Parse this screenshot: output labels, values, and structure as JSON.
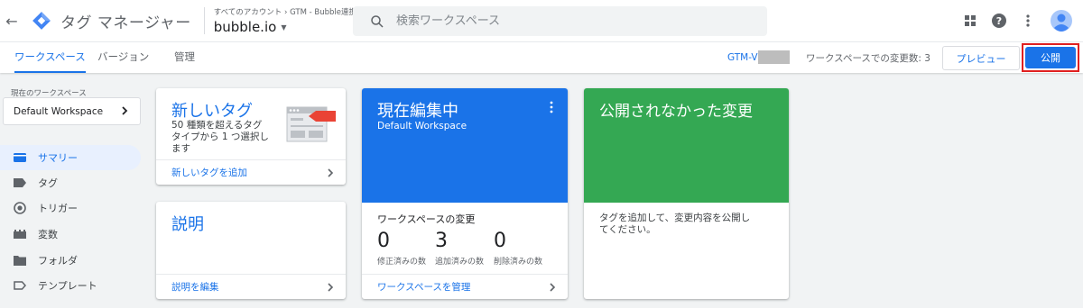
{
  "header": {
    "app_title": "タグ マネージャー",
    "account_path": "すべてのアカウント › GTM - Bubble連携",
    "container_name": "bubble.io",
    "search_placeholder": "検索ワークスペース"
  },
  "nav": {
    "tabs": [
      {
        "label": "ワークスペース",
        "active": true
      },
      {
        "label": "バージョン",
        "active": false
      },
      {
        "label": "管理",
        "active": false
      }
    ],
    "gtm_id": "GTM-V",
    "changes_text": "ワークスペースでの変更数: 3",
    "preview_label": "プレビュー",
    "publish_label": "公開"
  },
  "sidebar": {
    "current_ws_label": "現在のワークスペース",
    "current_ws": "Default Workspace",
    "items": [
      {
        "label": "サマリー",
        "icon": "summary-icon",
        "active": true
      },
      {
        "label": "タグ",
        "icon": "tag-icon",
        "active": false
      },
      {
        "label": "トリガー",
        "icon": "trigger-icon",
        "active": false
      },
      {
        "label": "変数",
        "icon": "variables-icon",
        "active": false
      },
      {
        "label": "フォルダ",
        "icon": "folder-icon",
        "active": false
      },
      {
        "label": "テンプレート",
        "icon": "template-icon",
        "active": false
      }
    ]
  },
  "cards": {
    "new_tag": {
      "title": "新しいタグ",
      "desc_lines": [
        "50 種類を超えるタグ",
        "タイプから 1 つ選択し",
        "ます"
      ],
      "link": "新しいタグを追加"
    },
    "description": {
      "title": "説明",
      "link": "説明を編集"
    },
    "editing": {
      "title": "現在編集中",
      "subtitle": "Default Workspace",
      "changes_title": "ワークスペースの変更",
      "stats": [
        {
          "value": "0",
          "label": "修正済みの数"
        },
        {
          "value": "3",
          "label": "追加済みの数"
        },
        {
          "value": "0",
          "label": "削除済みの数"
        }
      ],
      "link": "ワークスペースを管理"
    },
    "unpublished": {
      "title": "公開されなかった変更",
      "desc_lines": [
        "タグを追加して、変更内容を公開し",
        "てください。"
      ]
    }
  },
  "colors": {
    "accent": "#1a73e8",
    "editing_card": "#1a73e8",
    "unpublished_card": "#34a853",
    "publish_highlight": "#e02020"
  }
}
